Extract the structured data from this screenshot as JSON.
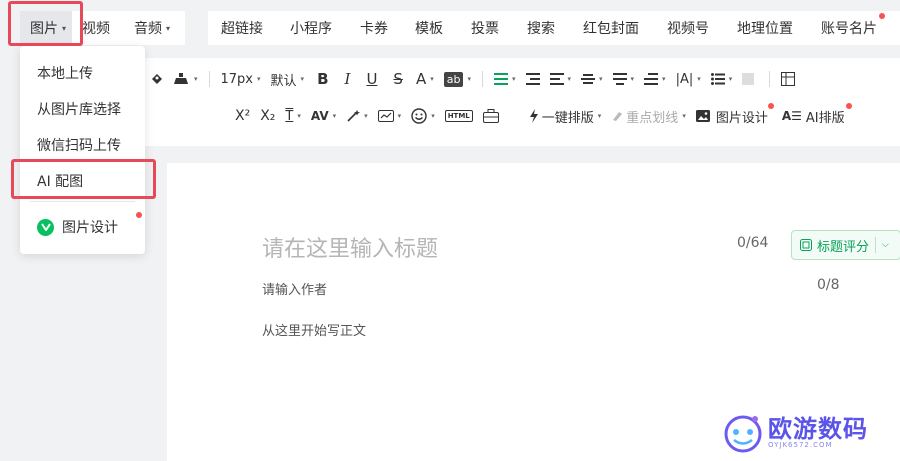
{
  "top_tabs": {
    "group1": [
      {
        "label": "图片",
        "caret": "▾"
      },
      {
        "label": "视频",
        "caret": ""
      },
      {
        "label": "音频",
        "caret": "▾"
      }
    ],
    "group2": [
      {
        "label": "超链接"
      },
      {
        "label": "小程序"
      },
      {
        "label": "卡券"
      },
      {
        "label": "模板"
      },
      {
        "label": "投票"
      },
      {
        "label": "搜索"
      },
      {
        "label": "红包封面"
      },
      {
        "label": "视频号"
      },
      {
        "label": "地理位置"
      },
      {
        "label": "账号名片"
      }
    ]
  },
  "image_menu": {
    "items": [
      "本地上传",
      "从图片库选择",
      "微信扫码上传",
      "AI 配图"
    ],
    "design": {
      "label": "图片设计",
      "icon": "design-logo-icon"
    }
  },
  "toolbar": {
    "font_size": "17px",
    "font_family": "默认",
    "bold": "B",
    "italic": "I",
    "underline": "U",
    "strike": "S",
    "font_color": "A",
    "bg_color": "ab",
    "superscript": "X²",
    "subscript": "X₂",
    "av": "AV",
    "html": "HTML",
    "one_click_layout": "一键排版",
    "key_underline": "重点划线",
    "image_design": "图片设计",
    "ai_layout": "AI排版",
    "ai_layout_icon_text": "A☰"
  },
  "editor": {
    "title_placeholder": "请在这里输入标题",
    "title_counter": "0/64",
    "score_button": "标题评分",
    "author_placeholder": "请输入作者",
    "author_counter": "0/8",
    "body_placeholder": "从这里开始写正文"
  },
  "watermark": {
    "text": "欧游数码",
    "sub": "OYJK6572.COM"
  },
  "colors": {
    "accent_green": "#07a35a",
    "highlight_red": "#e8495a",
    "dot_red": "#fa5151",
    "watermark_purple": "#5a55e8"
  }
}
